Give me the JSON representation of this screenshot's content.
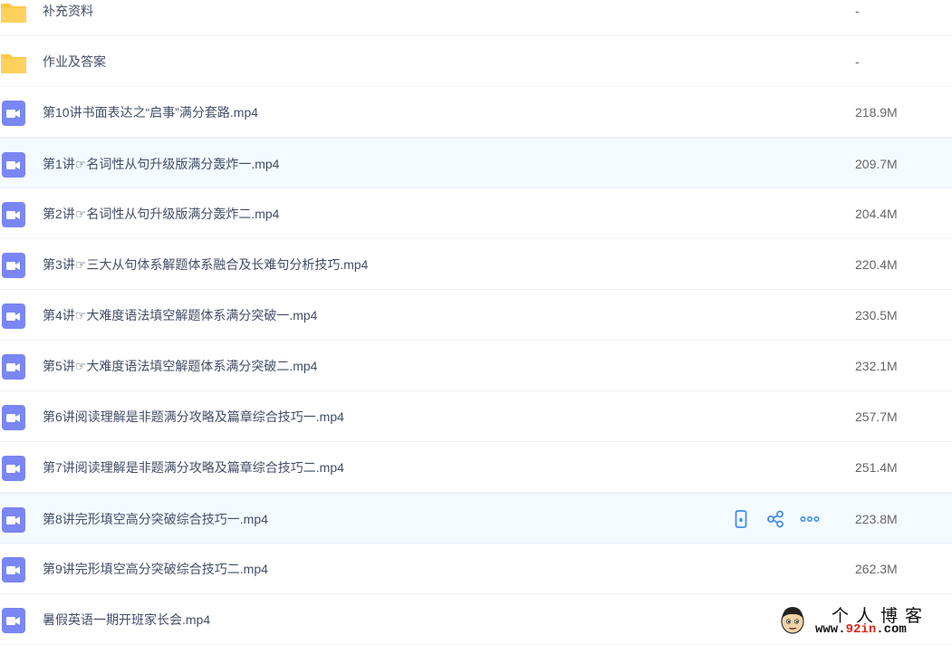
{
  "files": [
    {
      "type": "folder",
      "name": "补充资料",
      "size": "-"
    },
    {
      "type": "folder",
      "name": "作业及答案",
      "size": "-"
    },
    {
      "type": "video",
      "name": "第10讲书面表达之“启事”满分套路.mp4",
      "size": "218.9M"
    },
    {
      "type": "video",
      "name": "第1讲☞名词性从句升级版满分轰炸一.mp4",
      "size": "209.7M"
    },
    {
      "type": "video",
      "name": "第2讲☞名词性从句升级版满分轰炸二.mp4",
      "size": "204.4M"
    },
    {
      "type": "video",
      "name": "第3讲☞三大从句体系解题体系融合及长难句分析技巧.mp4",
      "size": "220.4M"
    },
    {
      "type": "video",
      "name": "第4讲☞大难度语法填空解题体系满分突破一.mp4",
      "size": "230.5M"
    },
    {
      "type": "video",
      "name": "第5讲☞大难度语法填空解题体系满分突破二.mp4",
      "size": "232.1M"
    },
    {
      "type": "video",
      "name": "第6讲阅读理解是非题满分攻略及篇章综合技巧一.mp4",
      "size": "257.7M"
    },
    {
      "type": "video",
      "name": "第7讲阅读理解是非题满分攻略及篇章综合技巧二.mp4",
      "size": "251.4M"
    },
    {
      "type": "video",
      "name": "第8讲完形填空高分突破综合技巧一.mp4",
      "size": "223.8M"
    },
    {
      "type": "video",
      "name": "第9讲完形填空高分突破综合技巧二.mp4",
      "size": "262.3M"
    },
    {
      "type": "video",
      "name": "暑假英语一期开班家长会.mp4",
      "size": ""
    }
  ],
  "row_actions": [
    {
      "icon": "phone-icon"
    },
    {
      "icon": "share-icon"
    },
    {
      "icon": "more-icon"
    }
  ],
  "watermark": {
    "line1": "个人博客",
    "line2_pre": "www.",
    "line2_hi": "92in",
    "line2_post": ".com"
  },
  "colors": {
    "folder": "#ffc847",
    "video": "#7a86f4",
    "action": "#3c8ef2",
    "highlight_bg": "#f4fbff"
  }
}
